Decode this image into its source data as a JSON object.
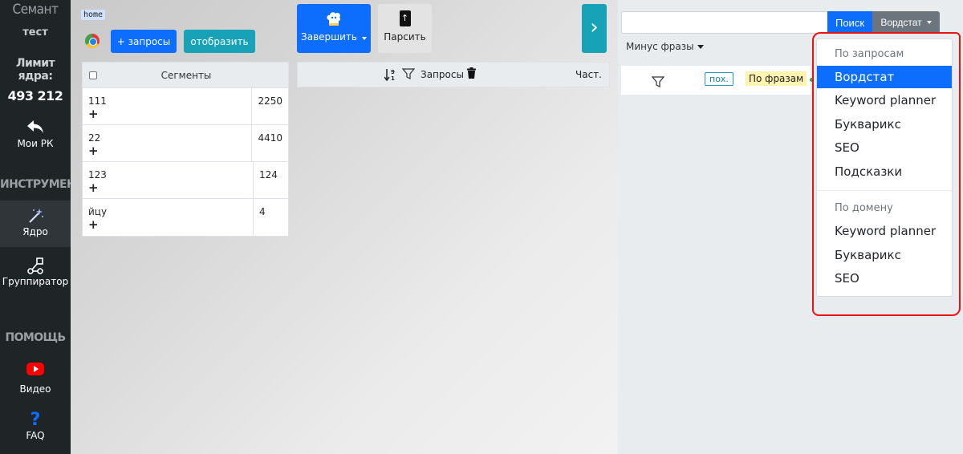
{
  "sidebar": {
    "brand": "Семант",
    "project": "тест",
    "limit_label": "Лимит ядра:",
    "limit_value": "493 212",
    "my_rk": "Мои РК",
    "tools_label": "ИНСТРУМЕНТЫ",
    "core": "Ядро",
    "grouper": "Группиратор",
    "help_label": "ПОМОЩЬ",
    "video": "Видео",
    "faq": "FAQ"
  },
  "main": {
    "home_badge": "home",
    "add_queries": "+ запросы",
    "show": "отобразить",
    "finish": "Завершить",
    "parse": "Парсить",
    "segments_header": "Сегменты",
    "segments": [
      {
        "name": "111",
        "value": "2250"
      },
      {
        "name": "22",
        "value": "4410"
      },
      {
        "name": "123",
        "value": "124"
      },
      {
        "name": "йцу",
        "value": "4"
      }
    ],
    "plus": "+",
    "queries_header": "Запросы",
    "freq_header": "Част."
  },
  "right": {
    "search_value": "",
    "search_button": "Поиск",
    "source_button": "Вордстат",
    "minus_phrases": "Минус фразы",
    "tag_poh": "пох.",
    "tag_phrases": "По фразам"
  },
  "dropdown": {
    "group1_header": "По запросам",
    "group1": [
      "Вордстат",
      "Keyword planner",
      "Букварикс",
      "SEO",
      "Подсказки"
    ],
    "group2_header": "По домену",
    "group2": [
      "Keyword planner",
      "Букварикс",
      "SEO"
    ],
    "active": "Вордстат"
  },
  "colors": {
    "primary": "#0d6efd",
    "teal": "#17a2b8",
    "sidebar": "#1f2426",
    "annotation": "#ee1111"
  }
}
